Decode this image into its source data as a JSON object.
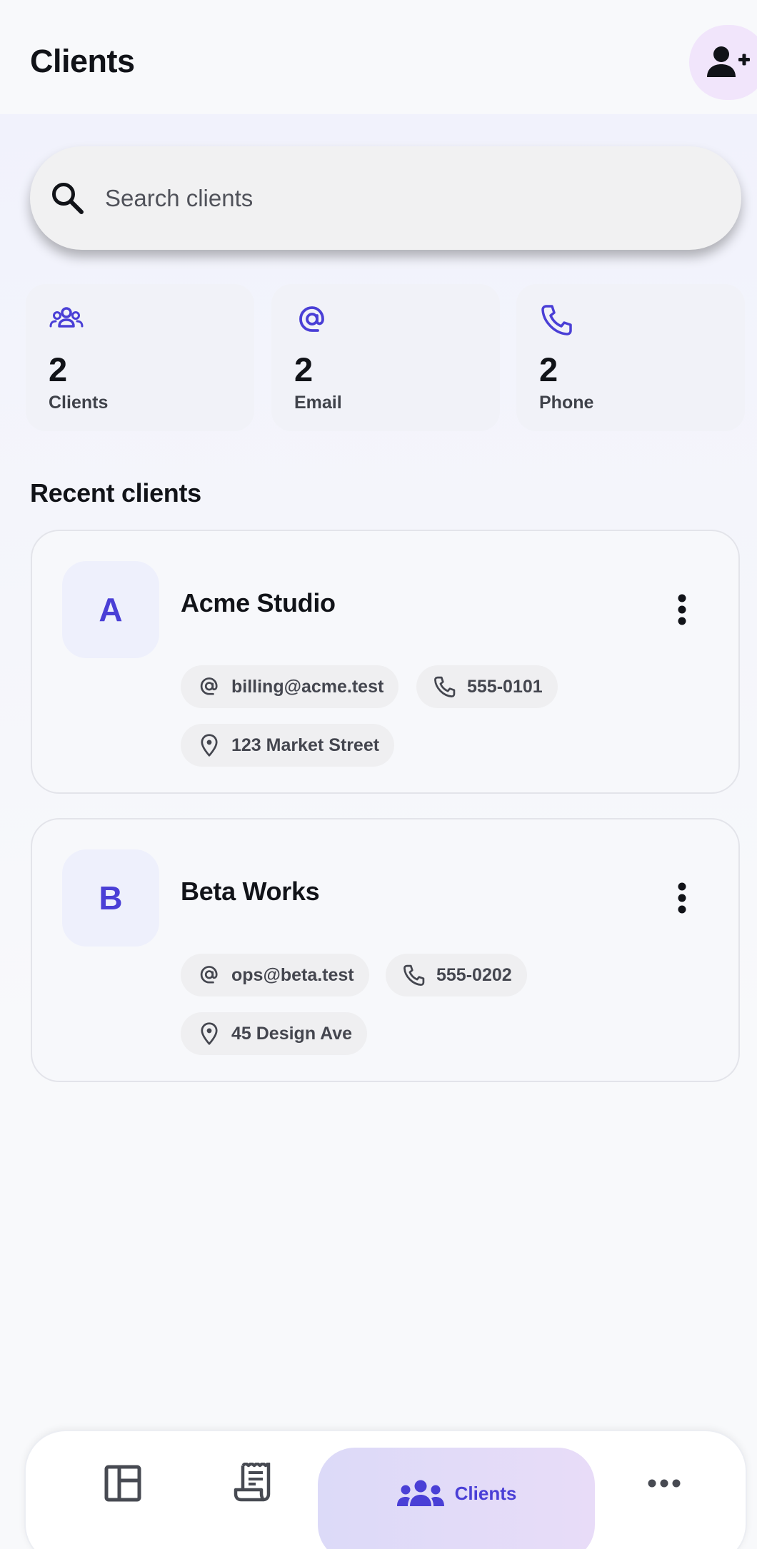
{
  "header": {
    "title": "Clients",
    "add_client_icon": "person-add-icon"
  },
  "search": {
    "placeholder": "Search clients",
    "value": "",
    "icon": "search-icon"
  },
  "stats": [
    {
      "icon": "group-icon",
      "value": "2",
      "label": "Clients"
    },
    {
      "icon": "at-sign-icon",
      "value": "2",
      "label": "Email"
    },
    {
      "icon": "phone-icon",
      "value": "2",
      "label": "Phone"
    }
  ],
  "recent": {
    "title": "Recent clients",
    "clients": [
      {
        "initial": "A",
        "name": "Acme Studio",
        "email": "billing@acme.test",
        "phone": "555-0101",
        "address": "123 Market Street"
      },
      {
        "initial": "B",
        "name": "Beta Works",
        "email": "ops@beta.test",
        "phone": "555-0202",
        "address": "45 Design Ave"
      }
    ]
  },
  "bottom_nav": {
    "items": [
      {
        "icon": "dashboard-icon",
        "label": ""
      },
      {
        "icon": "receipt-icon",
        "label": ""
      },
      {
        "icon": "groups-icon",
        "label": "Clients",
        "active": true
      },
      {
        "icon": "more-horizontal-icon",
        "label": ""
      }
    ]
  },
  "colors": {
    "accent": "#4a3fd6",
    "background": "#f8f9fb",
    "chip": "#efeff1",
    "add_button": "#f1e5fb"
  }
}
